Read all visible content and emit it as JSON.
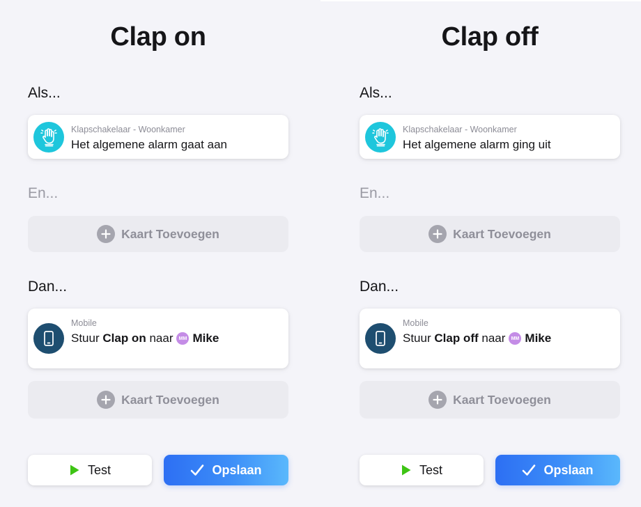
{
  "colors": {
    "background": "#f4f4f9",
    "trigger_icon_bg": "#1ec6dc",
    "action_icon_bg": "#1e4e70",
    "play_icon": "#3ec414",
    "save_gradient_start": "#2d6ff3",
    "save_gradient_end": "#5ab8fc",
    "avatar_bg": "#c48ce6"
  },
  "panels": [
    {
      "title": "Clap on",
      "if_label": "Als...",
      "and_label": "En...",
      "then_label": "Dan...",
      "trigger": {
        "icon": "hand-icon",
        "device": "Klapschakelaar - Woonkamer",
        "text": "Het algemene alarm gaat aan"
      },
      "add_card_and": "Kaart Toevoegen",
      "action": {
        "icon": "phone-icon",
        "device": "Mobile",
        "prefix": "Stuur",
        "message": "Clap on",
        "connector": "naar",
        "avatar_initials": "MM",
        "recipient": "Mike"
      },
      "add_card_then": "Kaart Toevoegen",
      "test_label": "Test",
      "save_label": "Opslaan"
    },
    {
      "title": "Clap off",
      "if_label": "Als...",
      "and_label": "En...",
      "then_label": "Dan...",
      "trigger": {
        "icon": "hand-icon",
        "device": "Klapschakelaar - Woonkamer",
        "text": "Het algemene alarm ging uit"
      },
      "add_card_and": "Kaart Toevoegen",
      "action": {
        "icon": "phone-icon",
        "device": "Mobile",
        "prefix": "Stuur",
        "message": "Clap off",
        "connector": "naar",
        "avatar_initials": "MM",
        "recipient": "Mike"
      },
      "add_card_then": "Kaart Toevoegen",
      "test_label": "Test",
      "save_label": "Opslaan"
    }
  ]
}
